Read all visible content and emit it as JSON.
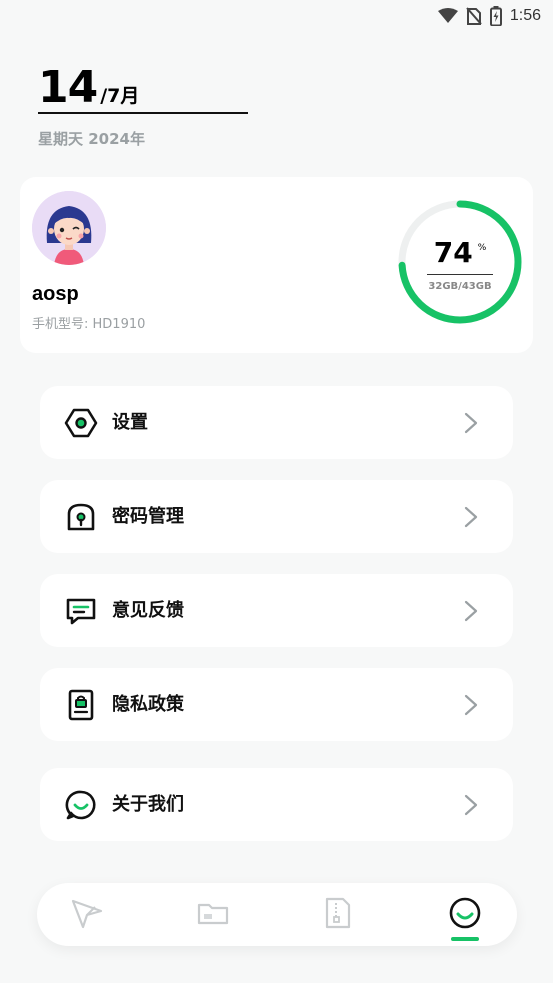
{
  "status_bar": {
    "time": "1:56",
    "icons": [
      "wifi-icon",
      "no-sim-icon",
      "battery-icon"
    ]
  },
  "date": {
    "day": "14",
    "month": "/7月",
    "sub": "星期天  2024年"
  },
  "profile": {
    "username": "aosp",
    "model": "手机型号: HD1910",
    "storage_percent": 74,
    "storage_percent_text": "74",
    "percent_unit": "%",
    "storage_text": "32GB/43GB"
  },
  "menu": [
    {
      "label": "设置",
      "icon": "settings-hexagon-icon"
    },
    {
      "label": "密码管理",
      "icon": "lock-icon"
    },
    {
      "label": "意见反馈",
      "icon": "feedback-message-icon"
    },
    {
      "label": "隐私政策",
      "icon": "privacy-document-icon"
    },
    {
      "label": "关于我们",
      "icon": "about-chat-icon"
    }
  ],
  "bottom_nav": {
    "items": [
      "send-icon",
      "folder-icon",
      "zip-file-icon",
      "profile-tab-icon"
    ],
    "active_index": 3
  },
  "colors": {
    "accent": "#17c266",
    "background": "#f7f8f8",
    "card": "#ffffff",
    "muted_text": "#9aa0a3"
  }
}
